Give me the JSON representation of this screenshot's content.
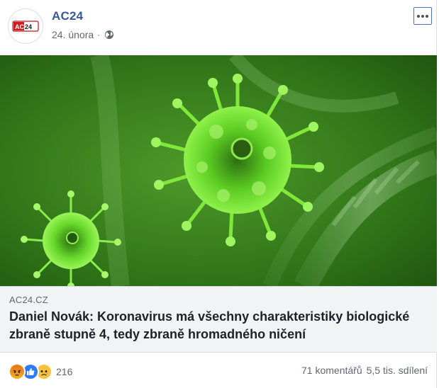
{
  "post": {
    "page_name": "AC24",
    "date": "24. února",
    "separator": "·",
    "privacy_icon": "globe-icon",
    "more_icon": "more-options-icon",
    "avatar_logo_text": "AC24"
  },
  "link": {
    "domain": "AC24.CZ",
    "title": "Daniel Novák: Koronavirus má všechny charakteristiky biologické zbraně stupně 4, tedy zbraně hromadného ničení"
  },
  "footer": {
    "reaction_icons": [
      "angry-reaction-icon",
      "like-reaction-icon",
      "sad-reaction-icon"
    ],
    "reaction_count": "216",
    "comments": "71 komentářů",
    "shares": "5,5 tis. sdílení"
  },
  "colors": {
    "page_name": "#385898",
    "meta_text": "#606770",
    "preview_bg": "#f2f3f5",
    "virus_green": "#6fe02a",
    "image_bg": "#2c6a16"
  }
}
